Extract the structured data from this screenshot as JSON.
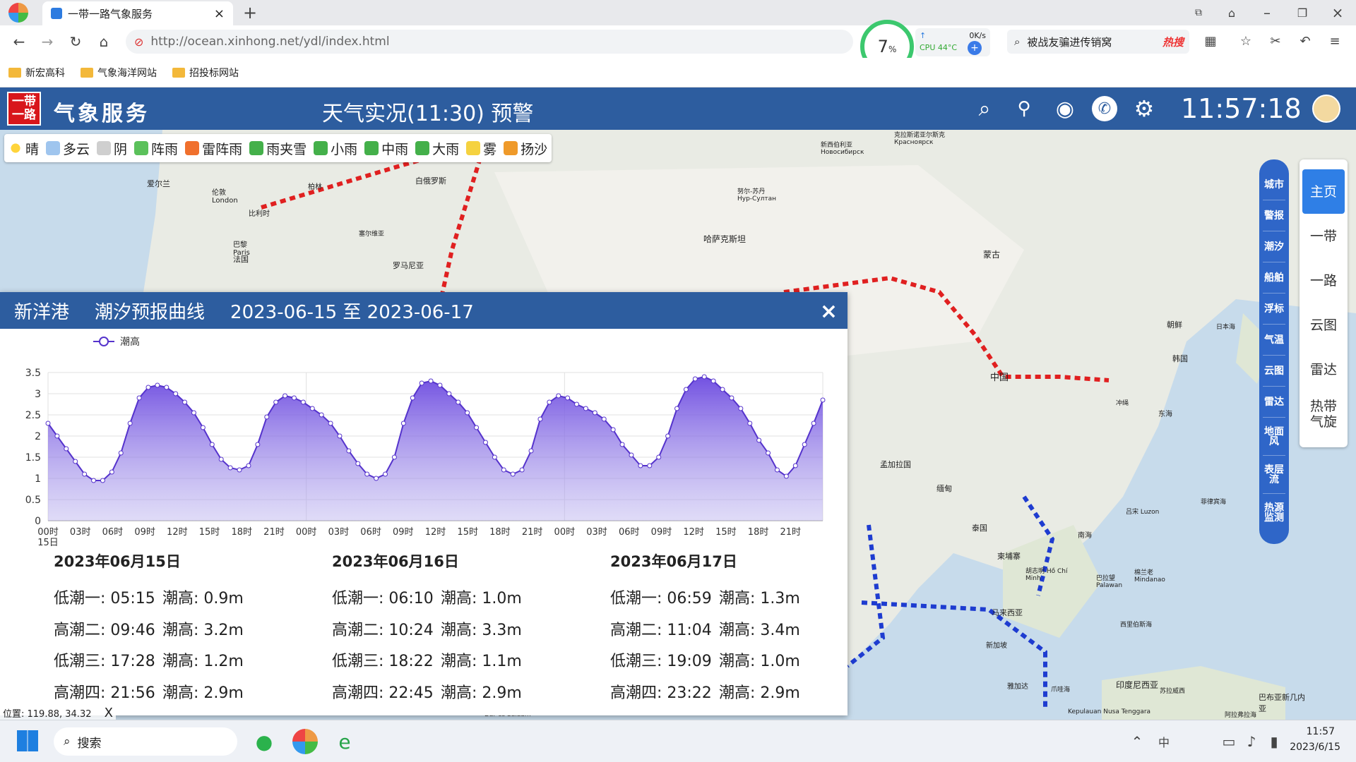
{
  "browser": {
    "tab_title": "一带一路气象服务",
    "url": "http://ocean.xinhong.net/ydl/index.html",
    "cpu_percent": "7",
    "percent_sign": "%",
    "net_speed": "0K/s",
    "cpu_temp": "CPU 44°C",
    "search_text": "被战友骗进传销窝",
    "hot_label": "热搜",
    "bookmarks": [
      "新宏高科",
      "气象海洋网站",
      "招投标网站"
    ]
  },
  "app": {
    "logo_text": "一带一路",
    "brand": "气象服务",
    "title": "天气实况(11:30) 预警",
    "clock": "11:57:18"
  },
  "legend": [
    "晴",
    "多云",
    "阴",
    "阵雨",
    "雷阵雨",
    "雨夹雪",
    "小雨",
    "中雨",
    "大雨",
    "雾",
    "扬沙"
  ],
  "right_nav": [
    "城市",
    "警报",
    "潮汐",
    "船舶",
    "浮标",
    "气温",
    "云图",
    "雷达",
    "地面风",
    "表层流",
    "热源监测"
  ],
  "right_menu": [
    "主页",
    "一带",
    "一路",
    "云图",
    "雷达",
    "热带气旋"
  ],
  "map_labels": [
    "爱尔兰",
    "伦敦 London",
    "巴黎 Paris",
    "法国",
    "比利时",
    "柏林",
    "白俄罗斯",
    "新西伯利亚 Новосибирск",
    "克拉斯诺亚尔斯克 Красноярск",
    "努尔-苏丹 Нур-Султан",
    "哈萨克斯坦",
    "蒙古",
    "罗马尼亚",
    "塞尔维亚",
    "朝鲜",
    "日本海",
    "韩国",
    "东海",
    "中国",
    "孟加拉国",
    "缅甸",
    "泰国",
    "柬埔寨",
    "胡志明 Hồ Chí Minh",
    "南海",
    "菲律宾海",
    "吕宋 Luzon",
    "棉兰老 Mindanao",
    "巴拉望 Palawan",
    "马来西亚",
    "西里伯斯海",
    "印度尼西亚",
    "苏拉威西",
    "爪哇海",
    "巴布亚新几内亚",
    "阿拉弗拉海",
    "Kepulauan Nusa Tenggara",
    "Dar es Salaam",
    "冲绳",
    "新加坡",
    "雅加达"
  ],
  "panel": {
    "port": "新洋港",
    "title": "潮汐预报曲线",
    "range": "2023-06-15 至 2023-06-17",
    "close": "×",
    "series_name": "潮高",
    "days": [
      {
        "date": "2023年06月15日",
        "rows": [
          [
            "低潮一: 05:15",
            "潮高: 0.9m"
          ],
          [
            "高潮二: 09:46",
            "潮高: 3.2m"
          ],
          [
            "低潮三: 17:28",
            "潮高: 1.2m"
          ],
          [
            "高潮四: 21:56",
            "潮高: 2.9m"
          ]
        ]
      },
      {
        "date": "2023年06月16日",
        "rows": [
          [
            "低潮一: 06:10",
            "潮高: 1.0m"
          ],
          [
            "高潮二: 10:24",
            "潮高: 3.3m"
          ],
          [
            "低潮三: 18:22",
            "潮高: 1.1m"
          ],
          [
            "高潮四: 22:45",
            "潮高: 2.9m"
          ]
        ]
      },
      {
        "date": "2023年06月17日",
        "rows": [
          [
            "低潮一: 06:59",
            "潮高: 1.3m"
          ],
          [
            "高潮二: 11:04",
            "潮高: 3.4m"
          ],
          [
            "低潮三: 19:09",
            "潮高: 1.0m"
          ],
          [
            "高潮四: 23:22",
            "潮高: 2.9m"
          ]
        ]
      }
    ]
  },
  "position": "位置: 119.88, 34.32",
  "position_close": "X",
  "taskbar": {
    "search": "搜索",
    "time": "11:57",
    "date": "2023/6/15"
  },
  "chart_data": {
    "type": "area",
    "series": [
      {
        "name": "潮高",
        "values": [
          2.3,
          2.0,
          1.7,
          1.4,
          1.1,
          0.95,
          0.95,
          1.15,
          1.6,
          2.3,
          2.9,
          3.15,
          3.2,
          3.15,
          3.0,
          2.8,
          2.55,
          2.2,
          1.8,
          1.45,
          1.25,
          1.2,
          1.3,
          1.8,
          2.45,
          2.8,
          2.95,
          2.9,
          2.8,
          2.65,
          2.5,
          2.3,
          2.0,
          1.65,
          1.35,
          1.1,
          1.0,
          1.1,
          1.5,
          2.3,
          2.9,
          3.25,
          3.3,
          3.2,
          3.0,
          2.8,
          2.55,
          2.2,
          1.85,
          1.5,
          1.2,
          1.1,
          1.2,
          1.65,
          2.4,
          2.8,
          2.95,
          2.9,
          2.75,
          2.65,
          2.55,
          2.4,
          2.15,
          1.8,
          1.55,
          1.3,
          1.3,
          1.5,
          2.0,
          2.65,
          3.1,
          3.35,
          3.4,
          3.3,
          3.1,
          2.9,
          2.65,
          2.3,
          1.9,
          1.6,
          1.2,
          1.05,
          1.3,
          1.8,
          2.3,
          2.85
        ]
      }
    ],
    "x_ticks": [
      "00时\n15日",
      "03时",
      "06时",
      "09时",
      "12时",
      "15时",
      "18时",
      "21时",
      "00时",
      "03时",
      "06时",
      "09时",
      "12时",
      "15时",
      "18时",
      "21时",
      "00时",
      "03时",
      "06时",
      "09时",
      "12时",
      "15时",
      "18时",
      "21时"
    ],
    "y_ticks": [
      "0",
      "0.5",
      "1",
      "1.5",
      "2",
      "2.5",
      "3",
      "3.5"
    ],
    "ylim": [
      0,
      3.5
    ],
    "grid": true,
    "legend_position": "top-left",
    "color": "#5533cc"
  }
}
